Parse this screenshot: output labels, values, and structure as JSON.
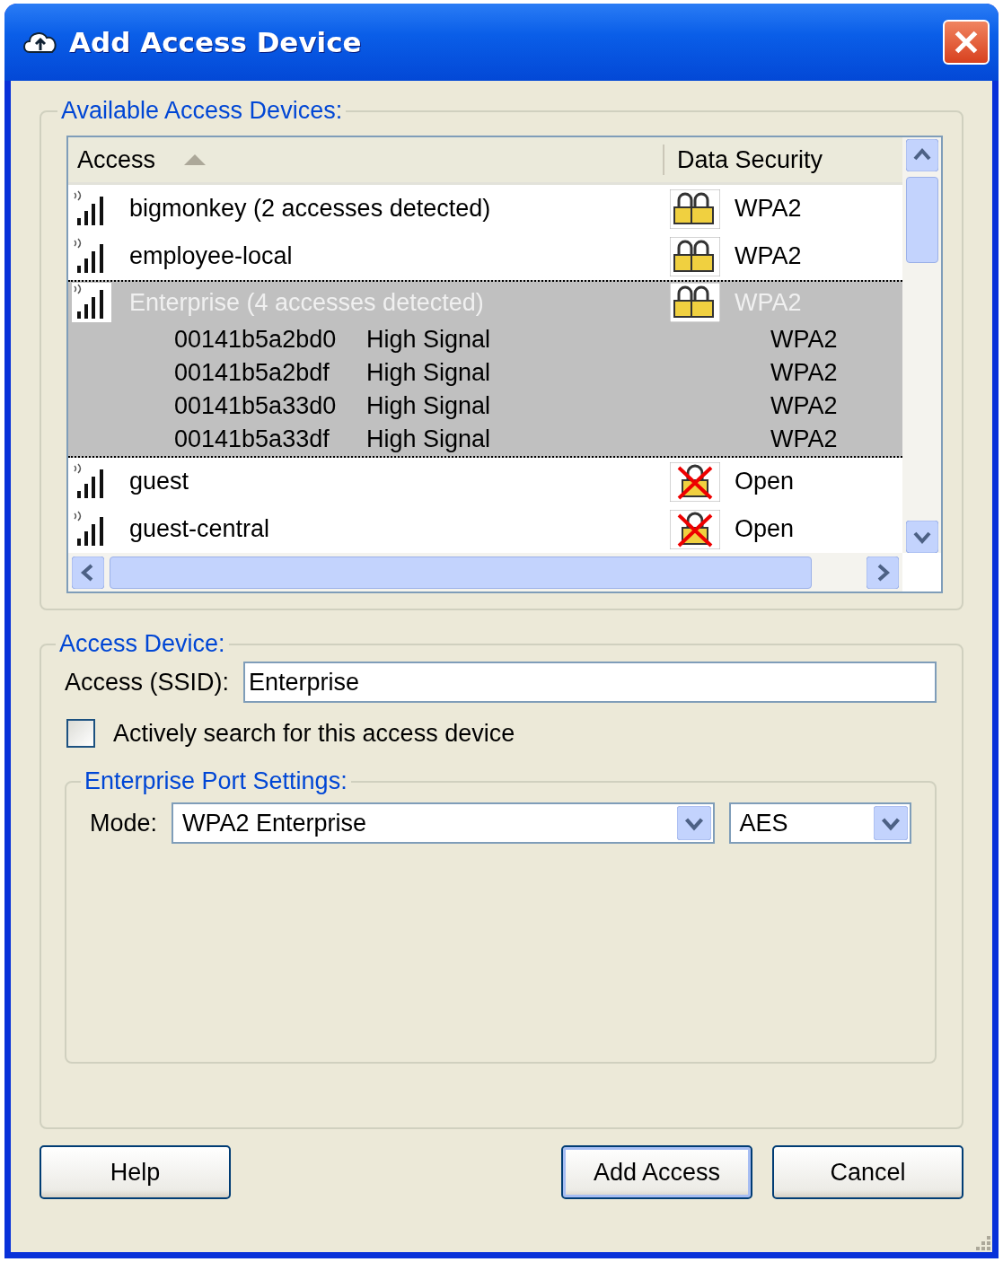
{
  "window": {
    "title": "Add Access Device"
  },
  "available": {
    "label": "Available Access Devices:",
    "columns": [
      {
        "label": "Access",
        "sorted": true
      },
      {
        "label": "Data Security"
      }
    ],
    "rows": [
      {
        "name": "bigmonkey (2 accesses detected)",
        "security": "WPA2",
        "locked": true,
        "selected": false
      },
      {
        "name": "employee-local",
        "security": "WPA2",
        "locked": true,
        "selected": false
      },
      {
        "name": "Enterprise (4 accesses detected)",
        "security": "WPA2",
        "locked": true,
        "selected": true,
        "children": [
          {
            "mac": "00141b5a2bd0",
            "signal": "High Signal",
            "security": "WPA2"
          },
          {
            "mac": "00141b5a2bdf",
            "signal": "High Signal",
            "security": "WPA2"
          },
          {
            "mac": "00141b5a33d0",
            "signal": "High Signal",
            "security": "WPA2"
          },
          {
            "mac": "00141b5a33df",
            "signal": "High Signal",
            "security": "WPA2"
          }
        ]
      },
      {
        "name": "guest",
        "security": "Open",
        "locked": false,
        "selected": false
      },
      {
        "name": "guest-central",
        "security": "Open",
        "locked": false,
        "selected": false
      }
    ]
  },
  "device": {
    "label": "Access Device:",
    "ssid_label": "Access (SSID):",
    "ssid": "Enterprise",
    "search": {
      "label": "Actively search for this access device",
      "checked": false
    },
    "port": {
      "label": "Enterprise Port Settings:",
      "mode_label": "Mode:",
      "mode": "WPA2 Enterprise",
      "cipher": "AES"
    }
  },
  "buttons": [
    {
      "label": "Help",
      "default": false
    },
    {
      "label": "Add Access",
      "default": true
    },
    {
      "label": "Cancel",
      "default": false
    }
  ]
}
